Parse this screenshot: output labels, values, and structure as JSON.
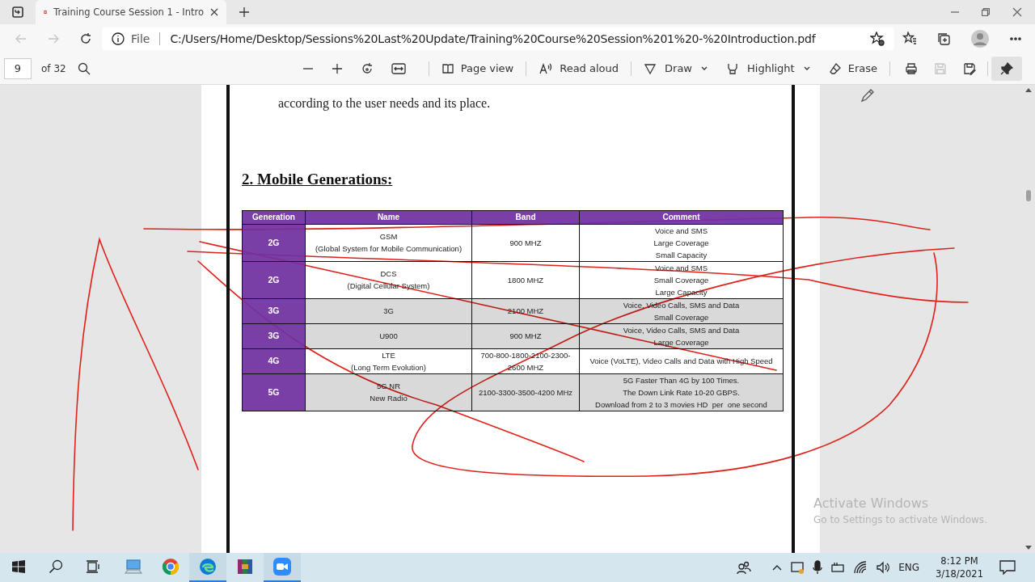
{
  "tabs": [
    {
      "label": "Training Course Session 1 - Intro",
      "selected": true
    }
  ],
  "address_bar": {
    "scheme": "File",
    "url": "C:/Users/Home/Desktop/Sessions%20Last%20Update/Training%20Course%20Session%201%20-%20Introduction.pdf"
  },
  "pdf_toolbar": {
    "page": "9",
    "page_count": "of 32",
    "tools": [
      {
        "kind": "page-view",
        "label": "Page view",
        "caret": false
      },
      {
        "kind": "read-aloud",
        "label": "Read aloud",
        "caret": false
      },
      {
        "kind": "draw",
        "label": "Draw",
        "caret": true
      },
      {
        "kind": "highlight",
        "label": "Highlight",
        "caret": true
      },
      {
        "kind": "erase",
        "label": "Erase",
        "caret": false
      }
    ],
    "icon_buttons": [
      {
        "kind": "print",
        "disabled": false,
        "on": false
      },
      {
        "kind": "save",
        "disabled": true,
        "on": false
      },
      {
        "kind": "save-as",
        "disabled": false,
        "on": false
      },
      {
        "kind": "pin",
        "disabled": false,
        "on": true
      }
    ]
  },
  "document": {
    "paragraph": "according to the user needs and its place.",
    "heading": "2. Mobile Generations:",
    "table": {
      "columns": [
        "Generation",
        "Name",
        "Band",
        "Comment"
      ],
      "rows": [
        {
          "shaded": false,
          "cells": [
            [
              "2G"
            ],
            [
              "GSM",
              "(Global System for Mobile Communication)"
            ],
            [
              "900 MHZ"
            ],
            [
              "Voice and SMS",
              "Large Coverage",
              "Small Capacity"
            ]
          ]
        },
        {
          "shaded": false,
          "cells": [
            [
              "2G"
            ],
            [
              "DCS",
              "(Digital Cellular System)"
            ],
            [
              "1800 MHZ"
            ],
            [
              "Voice and SMS",
              "Small Coverage",
              "Large Capacity"
            ]
          ]
        },
        {
          "shaded": true,
          "cells": [
            [
              "3G"
            ],
            [
              "3G"
            ],
            [
              "2100 MHZ"
            ],
            [
              "Voice, Video Calls, SMS and Data",
              "Small Coverage"
            ]
          ]
        },
        {
          "shaded": true,
          "cells": [
            [
              "3G"
            ],
            [
              "U900"
            ],
            [
              "900 MHZ"
            ],
            [
              "Voice, Video Calls, SMS and Data",
              "Large Coverage"
            ]
          ]
        },
        {
          "shaded": false,
          "cells": [
            [
              "4G"
            ],
            [
              "LTE",
              "(Long Term Evolution)"
            ],
            [
              "700-800-1800-2100-2300-",
              "2600 MHZ"
            ],
            [
              "Voice (VoLTE), Video Calls and Data with High Speed"
            ]
          ]
        },
        {
          "shaded": true,
          "cells": [
            [
              "5G"
            ],
            [
              "5G NR",
              "New Radio"
            ],
            [
              "2100-3300-3500-4200 MHz"
            ],
            [
              "5G Faster Than 4G by 100 Times.",
              "The Down Link Rate 10-20 GBPS.",
              "Download from 2 to 3 movies HD  per  one second"
            ]
          ]
        }
      ]
    }
  },
  "activation_notice": {
    "title": "Activate Windows",
    "detail": "Go to Settings to activate Windows."
  },
  "taskbar": {
    "apps": [
      {
        "kind": "computer",
        "running": false
      },
      {
        "kind": "chrome",
        "running": false
      },
      {
        "kind": "edge",
        "running": true
      },
      {
        "kind": "archive",
        "running": false
      },
      {
        "kind": "video",
        "running": true
      }
    ],
    "language": "ENG",
    "time": "8:12 PM",
    "date": "3/18/2021"
  }
}
